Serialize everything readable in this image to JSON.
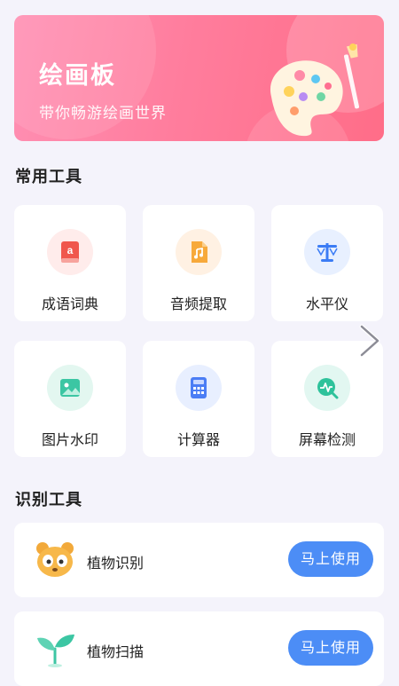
{
  "banner": {
    "title": "绘画板",
    "subtitle": "带你畅游绘画世界",
    "page_count": 3,
    "active_page": 1
  },
  "common_tools": {
    "section_title": "常用工具",
    "items": [
      {
        "label": "成语词典",
        "icon": "dictionary-icon",
        "bg": "#ffeceb",
        "color": "#f0574d"
      },
      {
        "label": "音频提取",
        "icon": "audio-file-icon",
        "bg": "#fff1e3",
        "color": "#f7a93b"
      },
      {
        "label": "水平仪",
        "icon": "level-icon",
        "bg": "#e8f0ff",
        "color": "#3b7cf5"
      },
      {
        "label": "图片水印",
        "icon": "image-icon",
        "bg": "#e3f7f0",
        "color": "#3cc6a3"
      },
      {
        "label": "计算器",
        "icon": "calculator-icon",
        "bg": "#e8efff",
        "color": "#4b7df5"
      },
      {
        "label": "屏幕检测",
        "icon": "screen-check-icon",
        "bg": "#e2f7f1",
        "color": "#2ec29b"
      }
    ]
  },
  "recognition_tools": {
    "section_title": "识别工具",
    "items": [
      {
        "label": "植物识别",
        "button": "马上使用",
        "icon": "panda-icon"
      },
      {
        "label": "植物扫描",
        "button": "马上使用",
        "icon": "sprout-icon"
      }
    ]
  },
  "colors": {
    "accent": "#4c8df6",
    "banner": "#ff7d9d",
    "background": "#f4f3fb"
  }
}
